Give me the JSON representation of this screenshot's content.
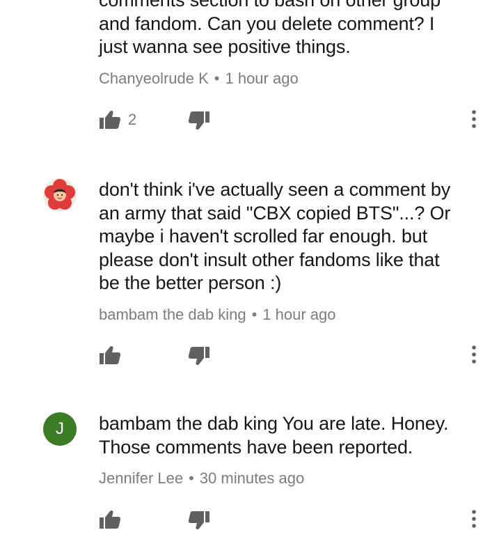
{
  "comments": [
    {
      "text": "comments section to bash on other group\nand fandom. Can you delete comment? I\njust wanna see positive things.",
      "author": "Chanyeolrude K",
      "time": "1 hour ago",
      "likes": "2"
    },
    {
      "avatar": "flower-profile-picture",
      "text": "don't think i've actually seen a comment by\nan army that said \"CBX copied BTS\"...? Or\nmaybe i haven't scrolled far enough. but\nplease don't insult other fandoms like that\nbe the better person :)",
      "author": "bambam the dab king",
      "time": "1 hour ago",
      "likes": ""
    },
    {
      "avatar_letter": "J",
      "avatar_color": "#3a7d25",
      "text": "bambam the dab king You are late. Honey.\nThose comments have been reported.",
      "author": "Jennifer Lee",
      "time": "30 minutes ago",
      "likes": ""
    }
  ],
  "meta_separator": "•",
  "icons": {
    "like": "thumbs-up-icon",
    "dislike": "thumbs-down-icon",
    "more": "more-vertical-icon"
  },
  "colors": {
    "text": "#161616",
    "meta": "#7c7c7c",
    "icon": "#606060",
    "avatar_green": "#3a7d25",
    "avatar_red": "#df3b3b"
  }
}
